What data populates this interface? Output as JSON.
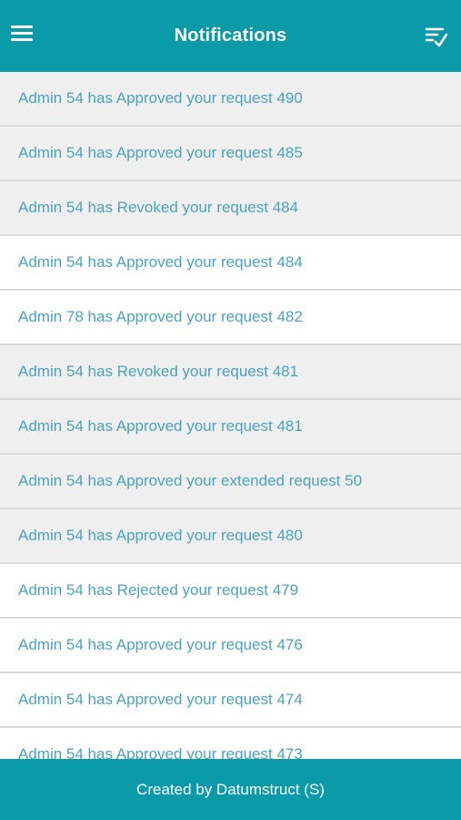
{
  "header": {
    "title": "Notifications",
    "menu_icon": "hamburger-menu-icon",
    "action_icon": "mark-all-read-icon"
  },
  "colors": {
    "primary": "#0a9aa8",
    "text": "#4aa3bd",
    "unread_bg": "#efefef",
    "read_bg": "#ffffff"
  },
  "notifications": [
    {
      "text": "Admin 54 has Approved your request 490",
      "state": "unread"
    },
    {
      "text": "Admin 54 has Approved your request 485",
      "state": "unread"
    },
    {
      "text": "Admin 54 has Revoked your request 484",
      "state": "unread"
    },
    {
      "text": "Admin 54 has Approved your request 484",
      "state": "read"
    },
    {
      "text": "Admin 78 has Approved your request 482",
      "state": "read"
    },
    {
      "text": "Admin 54 has Revoked your request 481",
      "state": "unread"
    },
    {
      "text": "Admin 54 has Approved your request 481",
      "state": "unread"
    },
    {
      "text": "Admin 54 has Approved your extended request 50",
      "state": "unread"
    },
    {
      "text": "Admin 54 has Approved your request 480",
      "state": "unread"
    },
    {
      "text": "Admin 54 has Rejected your request 479",
      "state": "read"
    },
    {
      "text": "Admin 54 has Approved your request 476",
      "state": "read"
    },
    {
      "text": "Admin 54 has Approved your request 474",
      "state": "read"
    },
    {
      "text": "Admin 54 has Approved your request 473",
      "state": "read"
    }
  ],
  "footer": {
    "text": "Created by Datumstruct (S)"
  }
}
